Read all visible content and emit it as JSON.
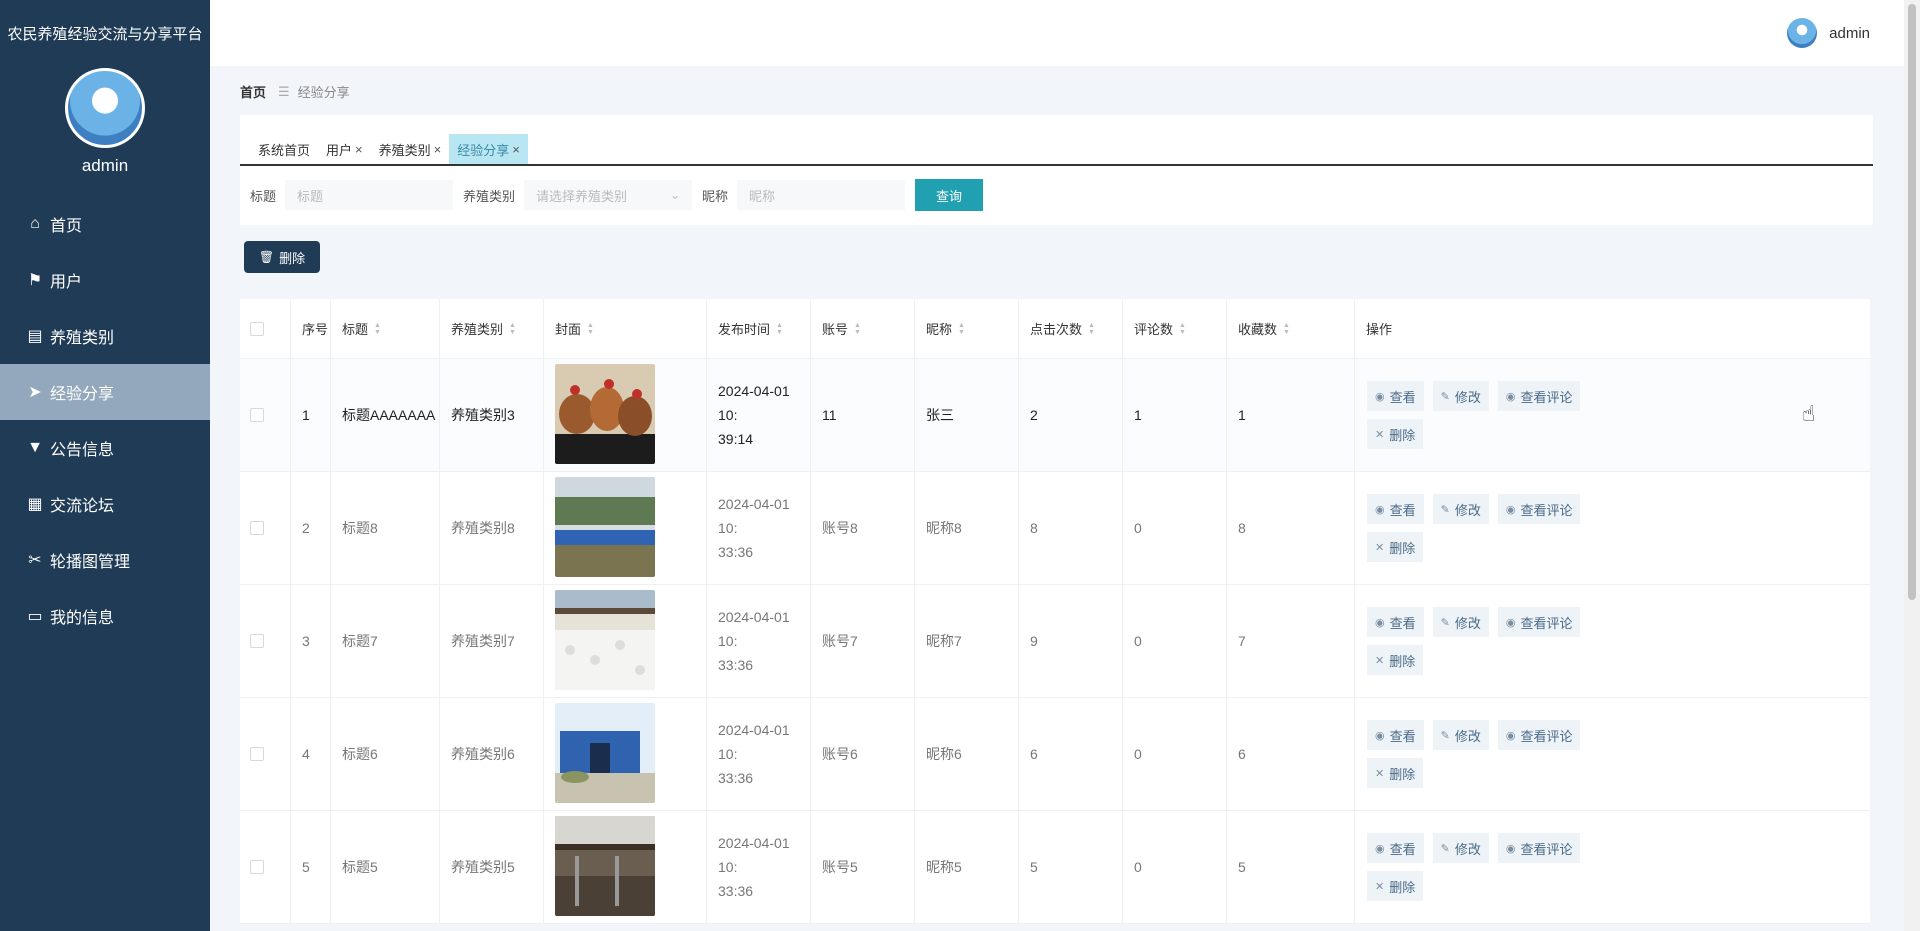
{
  "app": {
    "title": "农民养殖经验交流与分享平台"
  },
  "sidebar": {
    "username": "admin",
    "items": [
      {
        "label": "首页",
        "icon": "home-icon",
        "glyph": "⌂"
      },
      {
        "label": "用户",
        "icon": "flag-icon",
        "glyph": "⚑"
      },
      {
        "label": "养殖类别",
        "icon": "clipboard-icon",
        "glyph": "▤"
      },
      {
        "label": "经验分享",
        "icon": "send-icon",
        "glyph": "➤"
      },
      {
        "label": "公告信息",
        "icon": "notice-icon",
        "glyph": "▼"
      },
      {
        "label": "交流论坛",
        "icon": "grid-icon",
        "glyph": "▦"
      },
      {
        "label": "轮播图管理",
        "icon": "ticket-icon",
        "glyph": "✂"
      },
      {
        "label": "我的信息",
        "icon": "card-icon",
        "glyph": "▭"
      }
    ]
  },
  "topbar": {
    "username": "admin"
  },
  "breadcrumb": {
    "home": "首页",
    "separator": "☰",
    "current": "经验分享"
  },
  "tabs": [
    {
      "label": "系统首页",
      "closable": false
    },
    {
      "label": "用户",
      "closable": true
    },
    {
      "label": "养殖类别",
      "closable": true
    },
    {
      "label": "经验分享",
      "closable": true
    }
  ],
  "tab_close_glyph": "×",
  "search": {
    "title_label": "标题",
    "title_placeholder": "标题",
    "category_label": "养殖类别",
    "category_placeholder": "请选择养殖类别",
    "nickname_label": "昵称",
    "nickname_placeholder": "昵称",
    "query_button": "查询"
  },
  "toolbar": {
    "delete_button": "删除"
  },
  "table": {
    "columns": [
      "序号",
      "标题",
      "养殖类别",
      "封面",
      "发布时间",
      "账号",
      "昵称",
      "点击次数",
      "评论数",
      "收藏数",
      "操作"
    ],
    "actions": {
      "view": "查看",
      "edit": "修改",
      "view_comments": "查看评论",
      "delete": "删除"
    },
    "rows": [
      {
        "index": "1",
        "title": "标题AAAAAAA",
        "category": "养殖类别3",
        "time1": "2024-04-01 10:",
        "time2": "39:14",
        "account": "11",
        "nickname": "张三",
        "clicks": "2",
        "comments": "1",
        "favorites": "1",
        "cover": "chickens"
      },
      {
        "index": "2",
        "title": "标题8",
        "category": "养殖类别8",
        "time1": "2024-04-01 10:",
        "time2": "33:36",
        "account": "账号8",
        "nickname": "昵称8",
        "clicks": "8",
        "comments": "0",
        "favorites": "8",
        "cover": "barns"
      },
      {
        "index": "3",
        "title": "标题7",
        "category": "养殖类别7",
        "time1": "2024-04-01 10:",
        "time2": "33:36",
        "account": "账号7",
        "nickname": "昵称7",
        "clicks": "9",
        "comments": "0",
        "favorites": "7",
        "cover": "ducks"
      },
      {
        "index": "4",
        "title": "标题6",
        "category": "养殖类别6",
        "time1": "2024-04-01 10:",
        "time2": "33:36",
        "account": "账号6",
        "nickname": "昵称6",
        "clicks": "6",
        "comments": "0",
        "favorites": "6",
        "cover": "shed"
      },
      {
        "index": "5",
        "title": "标题5",
        "category": "养殖类别5",
        "time1": "2024-04-01 10:",
        "time2": "33:36",
        "account": "账号5",
        "nickname": "昵称5",
        "clicks": "5",
        "comments": "0",
        "favorites": "5",
        "cover": "stable"
      }
    ]
  }
}
